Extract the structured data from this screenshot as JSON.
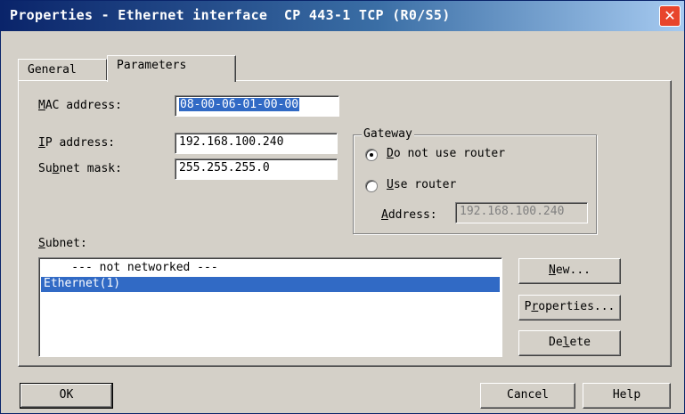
{
  "window": {
    "title": "Properties - Ethernet interface  CP 443-1 TCP (R0/S5)",
    "close_glyph": "✕"
  },
  "tabs": [
    {
      "label": "General",
      "active": false
    },
    {
      "label": "Parameters",
      "active": true
    }
  ],
  "mac": {
    "label_pre": "M",
    "label_rest": "AC address:",
    "value": "08-00-06-01-00-00"
  },
  "ip": {
    "label_pre": "I",
    "label_rest": "P address:",
    "value": "192.168.100.240"
  },
  "subnet_mask": {
    "label_a": "Su",
    "label_u": "b",
    "label_b": "net mask:",
    "value": "255.255.255.0"
  },
  "gateway": {
    "title": "Gateway",
    "option_no_router": {
      "u": "D",
      "rest": "o not use router",
      "checked": true
    },
    "option_use_router": {
      "u": "U",
      "rest": "se router",
      "checked": false
    },
    "address_label_u": "A",
    "address_label_rest": "ddress:",
    "address_value": "192.168.100.240"
  },
  "subnet": {
    "label_u": "S",
    "label_rest": "ubnet:",
    "items": [
      {
        "text": "    --- not networked ---",
        "selected": false
      },
      {
        "text": "Ethernet(1)",
        "selected": true
      }
    ]
  },
  "buttons": {
    "new_u": "N",
    "new_rest": "ew...",
    "properties_a": "P",
    "properties_u": "r",
    "properties_b": "operties...",
    "delete_a": "De",
    "delete_u": "l",
    "delete_b": "ete",
    "ok": "OK",
    "cancel": "Cancel",
    "help": "Help"
  }
}
